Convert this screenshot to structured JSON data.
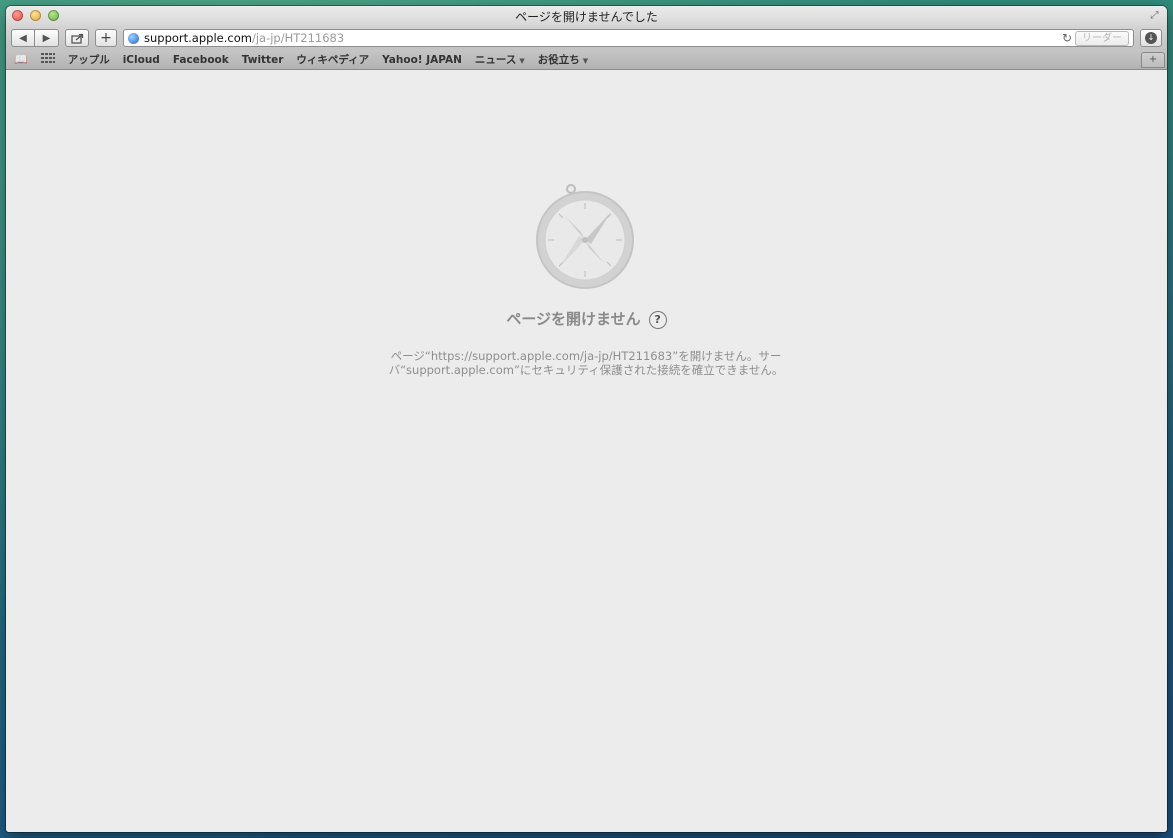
{
  "window": {
    "title": "ページを開けませんでした"
  },
  "toolbar": {
    "back_icon": "back-arrow-icon",
    "forward_icon": "forward-arrow-icon",
    "share_icon": "share-icon",
    "add_label": "+",
    "address": {
      "host": "support.apple.com",
      "path": "/ja-jp/HT211683"
    },
    "reader_label": "リーダー"
  },
  "bookmarks": {
    "items": [
      {
        "label": "アップル"
      },
      {
        "label": "iCloud"
      },
      {
        "label": "Facebook"
      },
      {
        "label": "Twitter"
      },
      {
        "label": "ウィキペディア"
      },
      {
        "label": "Yahoo! JAPAN"
      },
      {
        "label": "ニュース"
      },
      {
        "label": "お役立ち"
      }
    ]
  },
  "error": {
    "title": "ページを開けません",
    "help_label": "?",
    "message": "ページ“https://support.apple.com/ja-jp/HT211683”を開けません。サーバ“support.apple.com”にセキュリティ保護された接続を確立できません。"
  }
}
